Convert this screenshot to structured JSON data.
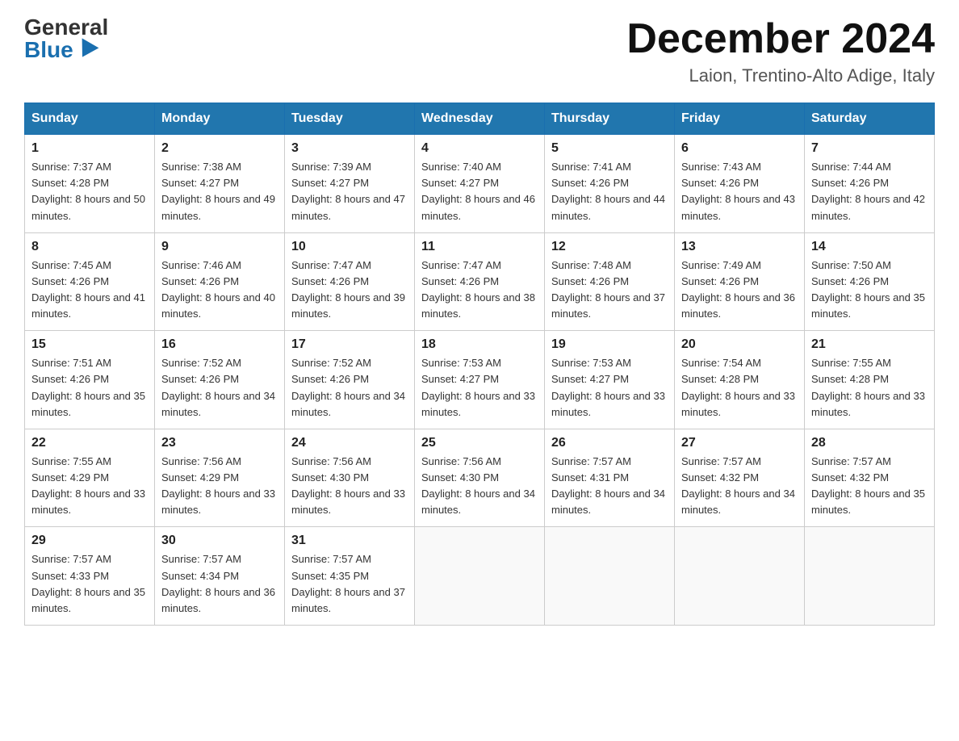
{
  "header": {
    "logo_general": "General",
    "logo_blue": "Blue",
    "title": "December 2024",
    "subtitle": "Laion, Trentino-Alto Adige, Italy"
  },
  "weekdays": [
    "Sunday",
    "Monday",
    "Tuesday",
    "Wednesday",
    "Thursday",
    "Friday",
    "Saturday"
  ],
  "weeks": [
    [
      {
        "day": "1",
        "sunrise": "7:37 AM",
        "sunset": "4:28 PM",
        "daylight": "8 hours and 50 minutes."
      },
      {
        "day": "2",
        "sunrise": "7:38 AM",
        "sunset": "4:27 PM",
        "daylight": "8 hours and 49 minutes."
      },
      {
        "day": "3",
        "sunrise": "7:39 AM",
        "sunset": "4:27 PM",
        "daylight": "8 hours and 47 minutes."
      },
      {
        "day": "4",
        "sunrise": "7:40 AM",
        "sunset": "4:27 PM",
        "daylight": "8 hours and 46 minutes."
      },
      {
        "day": "5",
        "sunrise": "7:41 AM",
        "sunset": "4:26 PM",
        "daylight": "8 hours and 44 minutes."
      },
      {
        "day": "6",
        "sunrise": "7:43 AM",
        "sunset": "4:26 PM",
        "daylight": "8 hours and 43 minutes."
      },
      {
        "day": "7",
        "sunrise": "7:44 AM",
        "sunset": "4:26 PM",
        "daylight": "8 hours and 42 minutes."
      }
    ],
    [
      {
        "day": "8",
        "sunrise": "7:45 AM",
        "sunset": "4:26 PM",
        "daylight": "8 hours and 41 minutes."
      },
      {
        "day": "9",
        "sunrise": "7:46 AM",
        "sunset": "4:26 PM",
        "daylight": "8 hours and 40 minutes."
      },
      {
        "day": "10",
        "sunrise": "7:47 AM",
        "sunset": "4:26 PM",
        "daylight": "8 hours and 39 minutes."
      },
      {
        "day": "11",
        "sunrise": "7:47 AM",
        "sunset": "4:26 PM",
        "daylight": "8 hours and 38 minutes."
      },
      {
        "day": "12",
        "sunrise": "7:48 AM",
        "sunset": "4:26 PM",
        "daylight": "8 hours and 37 minutes."
      },
      {
        "day": "13",
        "sunrise": "7:49 AM",
        "sunset": "4:26 PM",
        "daylight": "8 hours and 36 minutes."
      },
      {
        "day": "14",
        "sunrise": "7:50 AM",
        "sunset": "4:26 PM",
        "daylight": "8 hours and 35 minutes."
      }
    ],
    [
      {
        "day": "15",
        "sunrise": "7:51 AM",
        "sunset": "4:26 PM",
        "daylight": "8 hours and 35 minutes."
      },
      {
        "day": "16",
        "sunrise": "7:52 AM",
        "sunset": "4:26 PM",
        "daylight": "8 hours and 34 minutes."
      },
      {
        "day": "17",
        "sunrise": "7:52 AM",
        "sunset": "4:26 PM",
        "daylight": "8 hours and 34 minutes."
      },
      {
        "day": "18",
        "sunrise": "7:53 AM",
        "sunset": "4:27 PM",
        "daylight": "8 hours and 33 minutes."
      },
      {
        "day": "19",
        "sunrise": "7:53 AM",
        "sunset": "4:27 PM",
        "daylight": "8 hours and 33 minutes."
      },
      {
        "day": "20",
        "sunrise": "7:54 AM",
        "sunset": "4:28 PM",
        "daylight": "8 hours and 33 minutes."
      },
      {
        "day": "21",
        "sunrise": "7:55 AM",
        "sunset": "4:28 PM",
        "daylight": "8 hours and 33 minutes."
      }
    ],
    [
      {
        "day": "22",
        "sunrise": "7:55 AM",
        "sunset": "4:29 PM",
        "daylight": "8 hours and 33 minutes."
      },
      {
        "day": "23",
        "sunrise": "7:56 AM",
        "sunset": "4:29 PM",
        "daylight": "8 hours and 33 minutes."
      },
      {
        "day": "24",
        "sunrise": "7:56 AM",
        "sunset": "4:30 PM",
        "daylight": "8 hours and 33 minutes."
      },
      {
        "day": "25",
        "sunrise": "7:56 AM",
        "sunset": "4:30 PM",
        "daylight": "8 hours and 34 minutes."
      },
      {
        "day": "26",
        "sunrise": "7:57 AM",
        "sunset": "4:31 PM",
        "daylight": "8 hours and 34 minutes."
      },
      {
        "day": "27",
        "sunrise": "7:57 AM",
        "sunset": "4:32 PM",
        "daylight": "8 hours and 34 minutes."
      },
      {
        "day": "28",
        "sunrise": "7:57 AM",
        "sunset": "4:32 PM",
        "daylight": "8 hours and 35 minutes."
      }
    ],
    [
      {
        "day": "29",
        "sunrise": "7:57 AM",
        "sunset": "4:33 PM",
        "daylight": "8 hours and 35 minutes."
      },
      {
        "day": "30",
        "sunrise": "7:57 AM",
        "sunset": "4:34 PM",
        "daylight": "8 hours and 36 minutes."
      },
      {
        "day": "31",
        "sunrise": "7:57 AM",
        "sunset": "4:35 PM",
        "daylight": "8 hours and 37 minutes."
      },
      null,
      null,
      null,
      null
    ]
  ]
}
